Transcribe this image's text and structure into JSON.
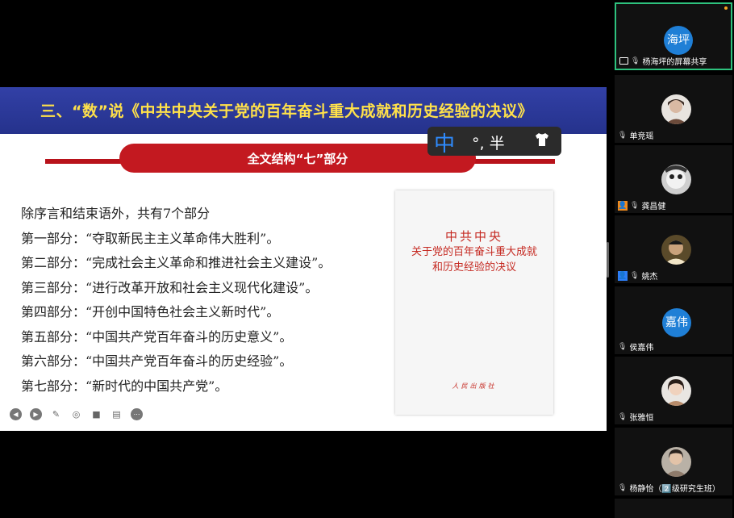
{
  "slide": {
    "banner_title": "三、“数”说《中共中央关于党的百年奋斗重大成就和历史经验的决议》",
    "subtitle": "全文结构“七”部分",
    "lines": [
      "除序言和结束语外，共有7个部分",
      "第一部分：“夺取新民主主义革命伟大胜利”。",
      "第二部分：“完成社会主义革命和推进社会主义建设”。",
      "第三部分：“进行改革开放和社会主义现代化建设”。",
      "第四部分：“开创中国特色社会主义新时代”。",
      "第五部分：“中国共产党百年奋斗的历史意义”。",
      "第六部分：“中国共产党百年奋斗的历史经验”。",
      "第七部分：“新时代的中国共产党”。"
    ],
    "book": {
      "line1": "中共中央",
      "line2": "关于党的百年奋斗重大成就",
      "line3": "和历史经验的决议",
      "publisher": "人民出版社"
    }
  },
  "ime": {
    "mode": "中",
    "rest": "°, 半",
    "icon": "shirt-icon"
  },
  "toolbar": {
    "icons": [
      "prev-icon",
      "next-icon",
      "pen-icon",
      "laser-icon",
      "camera-icon",
      "caption-icon",
      "more-icon"
    ]
  },
  "participants": [
    {
      "name": "杨海坪的屏幕共享",
      "avatar_text": "海坪",
      "type": "avatar",
      "active": true
    },
    {
      "name": "单竞瑶",
      "type": "photo"
    },
    {
      "name": "龚昌健",
      "type": "photo"
    },
    {
      "name": "姚杰",
      "type": "photo"
    },
    {
      "name": "侯嘉伟",
      "avatar_text": "嘉伟",
      "type": "avatar"
    },
    {
      "name": "张雅恒",
      "type": "photo"
    },
    {
      "name": "杨静怡（2️⃣级研究生班）",
      "type": "photo"
    }
  ],
  "colors": {
    "banner": "#2b389a",
    "banner_text": "#ffe14a",
    "accent_red": "#c31920",
    "avatar_blue": "#1f7fd6",
    "active_border": "#2ec27e"
  }
}
